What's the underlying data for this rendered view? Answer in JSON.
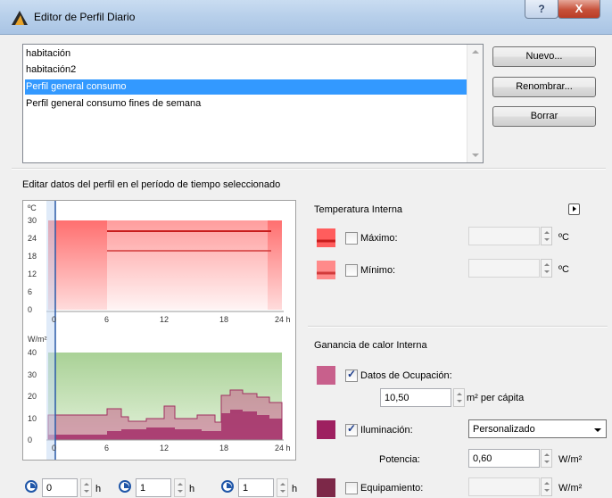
{
  "window": {
    "title": "Editor de Perfil Diario",
    "help_label": "?",
    "close_label": "X"
  },
  "profiles": {
    "items": [
      "habitación",
      "habitación2",
      "Perfil general consumo",
      "Perfil general consumo fines de semana"
    ],
    "selected_index": 2
  },
  "buttons": {
    "new": "Nuevo...",
    "rename": "Renombrar...",
    "delete": "Borrar"
  },
  "section_title": "Editar datos del perfil en el período de tiempo seleccionado",
  "graph": {
    "temp_unit": "ºC",
    "temp_ticks": [
      "30",
      "24",
      "18",
      "12",
      "6",
      "0"
    ],
    "x_ticks": [
      "0",
      "6",
      "12",
      "18",
      "24 h"
    ],
    "power_unit": "W/m²",
    "power_ticks": [
      "40",
      "30",
      "20",
      "10",
      "0"
    ]
  },
  "temperature": {
    "heading": "Temperatura Interna",
    "max_label": "Máximo:",
    "min_label": "Mínimo:",
    "unit": "ºC",
    "max_checked": false,
    "min_checked": false
  },
  "heat_gain": {
    "heading": "Ganancia de calor Interna",
    "occupancy_label": "Datos de Ocupación:",
    "occupancy_checked": true,
    "occupancy_value": "10,50",
    "occupancy_unit": "m² per cápita",
    "lighting_label": "Iluminación:",
    "lighting_checked": true,
    "lighting_mode": "Personalizado",
    "power_label": "Potencia:",
    "power_value": "0,60",
    "power_unit": "W/m²",
    "equipment_label": "Equipamiento:",
    "equipment_checked": false,
    "equipment_unit": "W/m²"
  },
  "time_controls": [
    {
      "value": "0",
      "unit": "h"
    },
    {
      "value": "1",
      "unit": "h"
    },
    {
      "value": "1",
      "unit": "h"
    }
  ],
  "colors": {
    "selection": "#3399ff",
    "temp_max": "#ff5d5d",
    "temp_min": "#ff8a8a",
    "occupancy": "#c8608c",
    "lighting": "#9e2060",
    "equipment": "#7c2848",
    "graph_green": "#b3d9a0"
  }
}
